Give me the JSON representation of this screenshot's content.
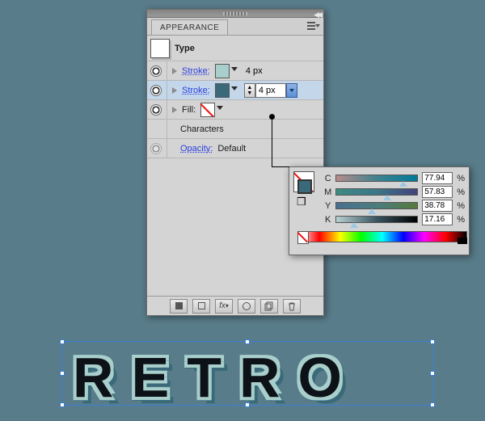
{
  "panel": {
    "title": "APPEARANCE",
    "target": "Type",
    "rows": [
      {
        "kind": "stroke",
        "label": "Stroke:",
        "swatch": "teal",
        "size_display": "4 px",
        "selected": false
      },
      {
        "kind": "stroke",
        "label": "Stroke:",
        "swatch": "darkteal",
        "size_value": "4 px",
        "selected": true
      },
      {
        "kind": "fill",
        "label": "Fill:",
        "swatch": "none"
      }
    ],
    "characters_label": "Characters",
    "opacity_label": "Opacity:",
    "opacity_value": "Default"
  },
  "cmyk": {
    "channels": [
      {
        "letter": "C",
        "value": "77.94",
        "knob": 78
      },
      {
        "letter": "M",
        "value": "57.83",
        "knob": 58
      },
      {
        "letter": "Y",
        "value": "38.78",
        "knob": 39
      },
      {
        "letter": "K",
        "value": "17.16",
        "knob": 17
      }
    ],
    "percent": "%"
  },
  "art": {
    "text": "RETRO"
  },
  "colors": {
    "stroke1": "#a9cfcd",
    "stroke2": "#3a6a79",
    "fill": "none"
  }
}
